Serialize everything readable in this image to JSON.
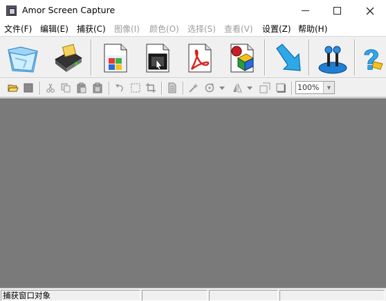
{
  "window": {
    "title": "Amor Screen Capture",
    "minimize_icon": "minimize-icon",
    "maximize_icon": "maximize-icon",
    "close_icon": "close-icon"
  },
  "menu": [
    {
      "label": "文件(F)",
      "enabled": true
    },
    {
      "label": "编辑(E)",
      "enabled": true
    },
    {
      "label": "捕获(C)",
      "enabled": true
    },
    {
      "label": "图像(I)",
      "enabled": false
    },
    {
      "label": "颜色(O)",
      "enabled": false
    },
    {
      "label": "选择(S)",
      "enabled": false
    },
    {
      "label": "查看(V)",
      "enabled": false
    },
    {
      "label": "设置(Z)",
      "enabled": true
    },
    {
      "label": "帮助(H)",
      "enabled": true
    }
  ],
  "big_toolbar": [
    {
      "icon": "open-folder-icon"
    },
    {
      "icon": "scanner-capture-icon"
    },
    {
      "icon": "capture-window-icon"
    },
    {
      "icon": "capture-object-icon"
    },
    {
      "icon": "capture-pdf-icon"
    },
    {
      "icon": "capture-3d-icon"
    },
    {
      "icon": "arrow-down-right-icon"
    },
    {
      "icon": "joystick-icon"
    },
    {
      "icon": "help-icon"
    }
  ],
  "small_toolbar": {
    "icons": [
      "open-icon",
      "stop-icon",
      "cut-icon",
      "copy-icon",
      "paste-icon",
      "paste-new-icon",
      "undo-icon",
      "select-icon",
      "crop-icon",
      "page-icon",
      "magic-wand-icon",
      "rotate-icon",
      "rotate-dropdown-icon",
      "flip-icon",
      "flip-dropdown-icon",
      "resize-icon",
      "frame-icon"
    ],
    "zoom_value": "100%"
  },
  "status": {
    "text": "捕获窗口对象",
    "pane2": "",
    "pane3": "",
    "pane4": ""
  },
  "colors": {
    "canvas": "#7a7a7a",
    "toolbar": "#f0f0f0",
    "disabled_text": "#9c9c9c"
  }
}
